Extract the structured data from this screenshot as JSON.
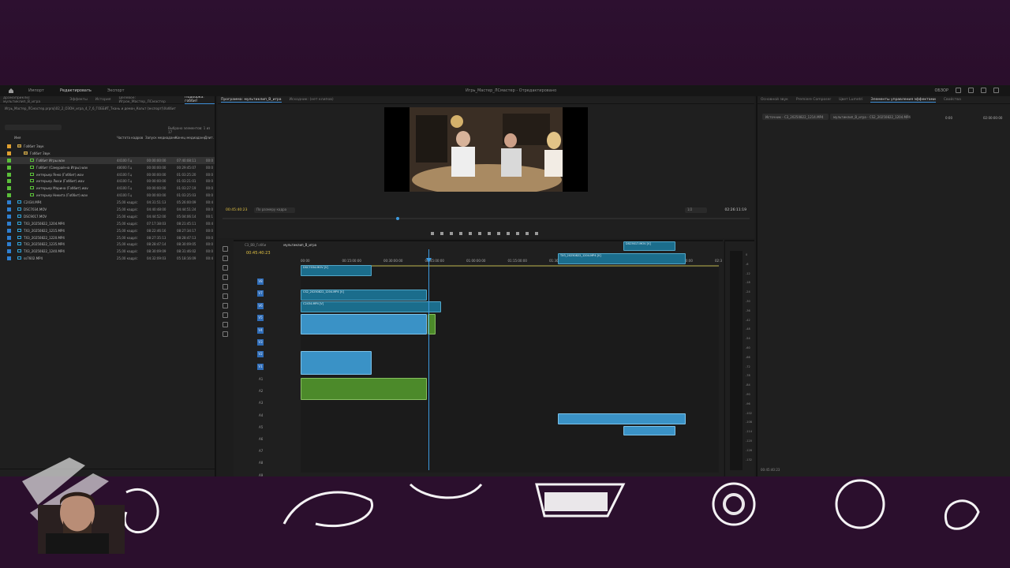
{
  "window": {
    "title": "Игрь_Мастер_ЛСмастер - Отредактировано",
    "modes": [
      "Импорт",
      "Редактировать",
      "Экспорт"
    ],
    "active_mode": "Редактировать",
    "right_label": "ОБЗОР"
  },
  "project_panel": {
    "tabs": [
      "драмаприклю: мультиклип_В_игра",
      "Эффекты",
      "История",
      "Целевое: Игрок_Мастер_ЛСмастер",
      "Подборка: гоббит"
    ],
    "active_tab": "Подборка: гоббит",
    "path": "Игрь_Мастер_ЛСмастер.prproj\\02_2_ОЗОН_игра_4_7_6_ГОББИТ_Ткань и демон_Кольт (экспорт)\\Хоббит",
    "selection_count": "Выбрано элементов: 1 из 17",
    "columns": [
      "Имя",
      "Частота кадров",
      "Запуск медиаданн.",
      "Конец медиаданн.",
      "Длит."
    ],
    "items": [
      {
        "name": "Гоббит Звук",
        "fps": "",
        "start": "",
        "end": "",
        "dur": "",
        "color": "#e0a030",
        "indent": 0,
        "type": "bin"
      },
      {
        "name": "Гоббит Звук",
        "fps": "",
        "start": "",
        "end": "",
        "dur": "",
        "color": "#e0a030",
        "indent": 1,
        "type": "bin"
      },
      {
        "name": "Гоббит Игры.wav",
        "fps": "44100 Гц",
        "start": "00:00:00:00",
        "end": "07:40:08:11",
        "dur": "00:0",
        "color": "#5bbf3a",
        "indent": 2,
        "type": "seq",
        "selected": true
      },
      {
        "name": "Гоббит (Самурай-на Игры).wav",
        "fps": "48000 Гц",
        "start": "00:00:00:00",
        "end": "00:29:45:07",
        "dur": "00:0",
        "color": "#5bbf3a",
        "indent": 2,
        "type": "seq"
      },
      {
        "name": "интерьер Янко (Гоббит).wav",
        "fps": "44100 Гц",
        "start": "00:00:00:00",
        "end": "01:03:25:20",
        "dur": "00:0",
        "color": "#5bbf3a",
        "indent": 2,
        "type": "seq"
      },
      {
        "name": "интерьер Люси (Гоббит).wav",
        "fps": "44100 Гц",
        "start": "00:00:00:00",
        "end": "01:03:21:01",
        "dur": "00:0",
        "color": "#5bbf3a",
        "indent": 2,
        "type": "seq"
      },
      {
        "name": "интерьер Марина (Гоббит).wav",
        "fps": "44100 Гц",
        "start": "00:00:00:00",
        "end": "01:03:27:19",
        "dur": "00:0",
        "color": "#5bbf3a",
        "indent": 2,
        "type": "seq"
      },
      {
        "name": "интерьер Никита (Гоббит).wav",
        "fps": "44100 Гц",
        "start": "00:00:00:00",
        "end": "01:03:25:03",
        "dur": "00:0",
        "color": "#5bbf3a",
        "indent": 2,
        "type": "seq"
      },
      {
        "name": "C2434.MP4",
        "fps": "25,00 кадр/с",
        "start": "04:31:51:13",
        "end": "05:26:00:09",
        "dur": "00:4",
        "color": "#2e7fd0",
        "indent": 0,
        "type": "clip"
      },
      {
        "name": "DSC7034.MOV",
        "fps": "25,00 кадр/с",
        "start": "04:40:48:00",
        "end": "04:44:51:24",
        "dur": "00:0",
        "color": "#2e7fd0",
        "indent": 0,
        "type": "clip"
      },
      {
        "name": "DSC9017.MOV",
        "fps": "25,00 кадр/с",
        "start": "04:44:52:00",
        "end": "05:04:06:14",
        "dur": "00:1",
        "color": "#2e7fd0",
        "indent": 0,
        "type": "clip"
      },
      {
        "name": "TX3_20250822_1204.MP4",
        "fps": "25,00 кадр/с",
        "start": "07:17:38:03",
        "end": "08:21:45:11",
        "dur": "00:4",
        "color": "#2e7fd0",
        "indent": 0,
        "type": "clip"
      },
      {
        "name": "TX3_20250822_1215.MP4",
        "fps": "25,00 кадр/с",
        "start": "08:22:46:16",
        "end": "08:27:34:17",
        "dur": "00:0",
        "color": "#2e7fd0",
        "indent": 0,
        "type": "clip"
      },
      {
        "name": "TX3_20250822_1220.MP4",
        "fps": "25,00 кадр/с",
        "start": "08:27:35:13",
        "end": "08:28:47:13",
        "dur": "00:0",
        "color": "#2e7fd0",
        "indent": 0,
        "type": "clip"
      },
      {
        "name": "TX3_20250822_1235.MP4",
        "fps": "25,00 кадр/с",
        "start": "08:28:47:14",
        "end": "08:30:09:05",
        "dur": "00:0",
        "color": "#2e7fd0",
        "indent": 0,
        "type": "clip"
      },
      {
        "name": "TX3_20250822_1240.MP4",
        "fps": "25,00 кадр/с",
        "start": "08:30:09:09",
        "end": "08:31:46:02",
        "dur": "00:0",
        "color": "#2e7fd0",
        "indent": 0,
        "type": "clip"
      },
      {
        "name": "ss7602.MP4",
        "fps": "25,00 кадр/с",
        "start": "04:32:09:03",
        "end": "05:18:16:09",
        "dur": "00:4",
        "color": "#2e7fd0",
        "indent": 0,
        "type": "clip"
      }
    ]
  },
  "program_monitor": {
    "tabs": [
      "Программа: мультиклип_В_игра",
      "Исходник: (нет клипов)"
    ],
    "active_tab": "Программа: мультиклип_В_игра",
    "timecode": "00:45:40:23",
    "fit": "По размеру кадра",
    "quality": "1/2",
    "duration": "02:26:11:19"
  },
  "effects_panel": {
    "tabs": [
      "Основной звук",
      "Premiere Composer",
      "Цвет Lumetri",
      "Элементы управления эффектами",
      "Свойства"
    ],
    "active_tab": "Элементы управления эффектами",
    "source_clip": "Источник - C3_20250822_1214.MP4",
    "target_clip": "мультиклип_В_игра - CS2_20250822_1204.MP4",
    "tc_a": "0:00",
    "tc_b": "02:00:00:00",
    "footer_tc": "00:45:40:23"
  },
  "timeline": {
    "tabs": [
      "С3_ВВ_Гобби",
      "мультиклип_В_игра"
    ],
    "active_tab": "мультиклип_В_игра",
    "timecode": "00:45:40:23",
    "ruler": [
      "00:00",
      "00:15:00:00",
      "00:30:00:00",
      "00:45:00:00",
      "01:00:00:00",
      "01:15:00:00",
      "01:30:00:00",
      "01:45:00:00",
      "02:00:00:00",
      "02:15:00:00",
      "02:3"
    ],
    "video_tracks": [
      "V8",
      "V7",
      "V6",
      "V5",
      "V4",
      "V3",
      "V2",
      "V1"
    ],
    "audio_tracks": [
      "A1",
      "A2",
      "A3",
      "A4",
      "A5",
      "A6",
      "A7",
      "A8",
      "A9"
    ],
    "audio_labels": {
      "A2": "Аудио 2",
      "A3": "Аудио 3",
      "A4": "Аудио 4"
    },
    "clip_labels": {
      "v8": "DSC9017.MOV [V]",
      "v7": "TX3_20250822_1204.MP4 [V]",
      "v6": "DSC7034.MOV [V]",
      "v3": "CS2_20250822_1204.MP4 [V]",
      "v2": "C2434.MP4 [V]"
    }
  },
  "meter": {
    "scale": [
      "0",
      "-6",
      "-12",
      "-18",
      "-24",
      "-30",
      "-36",
      "-42",
      "-48",
      "-54",
      "-60",
      "-66",
      "-72",
      "-78",
      "-84",
      "-90",
      "-96",
      "-102",
      "-108",
      "-114",
      "-120",
      "-126",
      "-132"
    ]
  },
  "colors": {
    "accent": "#3d9be0",
    "video_clip": "#1b6d8c",
    "audio_clip": "#3a92c6",
    "green_clip": "#4c8a2a",
    "timecode": "#e0c043"
  }
}
